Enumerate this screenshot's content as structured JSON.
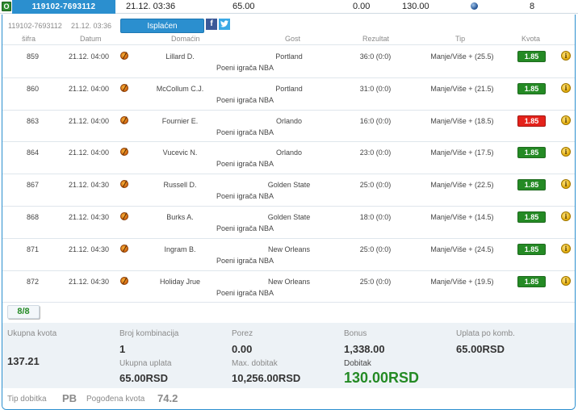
{
  "topbar": {
    "badge": "O",
    "ticket_tab": "119102-7693112",
    "date": "21.12. 03:36",
    "amount": "65.00",
    "zero": "0.00",
    "win": "130.00",
    "count": "8"
  },
  "ticket": {
    "id": "119102-7693112",
    "date": "21.12. 03:36",
    "status": "Isplaćen",
    "facebook_icon": "f",
    "twitter_icon": "t"
  },
  "headers": {
    "sifra": "šifra",
    "datum": "Datum",
    "domacin": "Domaćin",
    "gost": "Gost",
    "rezultat": "Rezultat",
    "tip": "Tip",
    "kvota": "Kvota"
  },
  "bets": [
    {
      "sifra": "859",
      "datum": "21.12. 04:00",
      "domacin": "Lillard D.",
      "gost": "Portland",
      "market": "Poeni igrača NBA",
      "rezultat": "36:0 (0:0)",
      "tip": "Manje/Više + (25.5)",
      "kvota": "1.85",
      "status": "won"
    },
    {
      "sifra": "860",
      "datum": "21.12. 04:00",
      "domacin": "McCollum C.J.",
      "gost": "Portland",
      "market": "Poeni igrača NBA",
      "rezultat": "31:0 (0:0)",
      "tip": "Manje/Više + (21.5)",
      "kvota": "1.85",
      "status": "won"
    },
    {
      "sifra": "863",
      "datum": "21.12. 04:00",
      "domacin": "Fournier E.",
      "gost": "Orlando",
      "market": "Poeni igrača NBA",
      "rezultat": "16:0 (0:0)",
      "tip": "Manje/Više + (18.5)",
      "kvota": "1.85",
      "status": "lost"
    },
    {
      "sifra": "864",
      "datum": "21.12. 04:00",
      "domacin": "Vucevic N.",
      "gost": "Orlando",
      "market": "Poeni igrača NBA",
      "rezultat": "23:0 (0:0)",
      "tip": "Manje/Više + (17.5)",
      "kvota": "1.85",
      "status": "won"
    },
    {
      "sifra": "867",
      "datum": "21.12. 04:30",
      "domacin": "Russell D.",
      "gost": "Golden State",
      "market": "Poeni igrača NBA",
      "rezultat": "25:0 (0:0)",
      "tip": "Manje/Više + (22.5)",
      "kvota": "1.85",
      "status": "won"
    },
    {
      "sifra": "868",
      "datum": "21.12. 04:30",
      "domacin": "Burks A.",
      "gost": "Golden State",
      "market": "Poeni igrača NBA",
      "rezultat": "18:0 (0:0)",
      "tip": "Manje/Više + (14.5)",
      "kvota": "1.85",
      "status": "won"
    },
    {
      "sifra": "871",
      "datum": "21.12. 04:30",
      "domacin": "Ingram B.",
      "gost": "New Orleans",
      "market": "Poeni igrača NBA",
      "rezultat": "25:0 (0:0)",
      "tip": "Manje/Više + (24.5)",
      "kvota": "1.85",
      "status": "won"
    },
    {
      "sifra": "872",
      "datum": "21.12. 04:30",
      "domacin": "Holiday Jrue",
      "gost": "New Orleans",
      "market": "Poeni igrača NBA",
      "rezultat": "25:0 (0:0)",
      "tip": "Manje/Više + (19.5)",
      "kvota": "1.85",
      "status": "won"
    }
  ],
  "info_icon": "i",
  "count_badge": "8/8",
  "summary": {
    "ukupna_kvota_label": "Ukupna kvota",
    "ukupna_kvota": "137.21",
    "broj_kombinacija_label": "Broj kombinacija",
    "broj_kombinacija": "1",
    "ukupna_uplata_label": "Ukupna uplata",
    "ukupna_uplata": "65.00RSD",
    "porez_label": "Porez",
    "porez": "0.00",
    "max_dobitak_label": "Max. dobitak",
    "max_dobitak": "10,256.00RSD",
    "bonus_label": "Bonus",
    "bonus": "1,338.00",
    "dobitak_label": "Dobitak",
    "dobitak": "130.00RSD",
    "uplata_po_komb_label": "Uplata po komb.",
    "uplata_po_komb": "65.00RSD"
  },
  "footer": {
    "tip_dobitka_label": "Tip dobitka",
    "tip_dobitka": "PB",
    "pogodena_kvota_label": "Pogođena kvota",
    "pogodena_kvota": "74.2"
  },
  "colors": {
    "accent": "#2b8fcf",
    "won": "#248a24",
    "lost": "#e4221b"
  }
}
